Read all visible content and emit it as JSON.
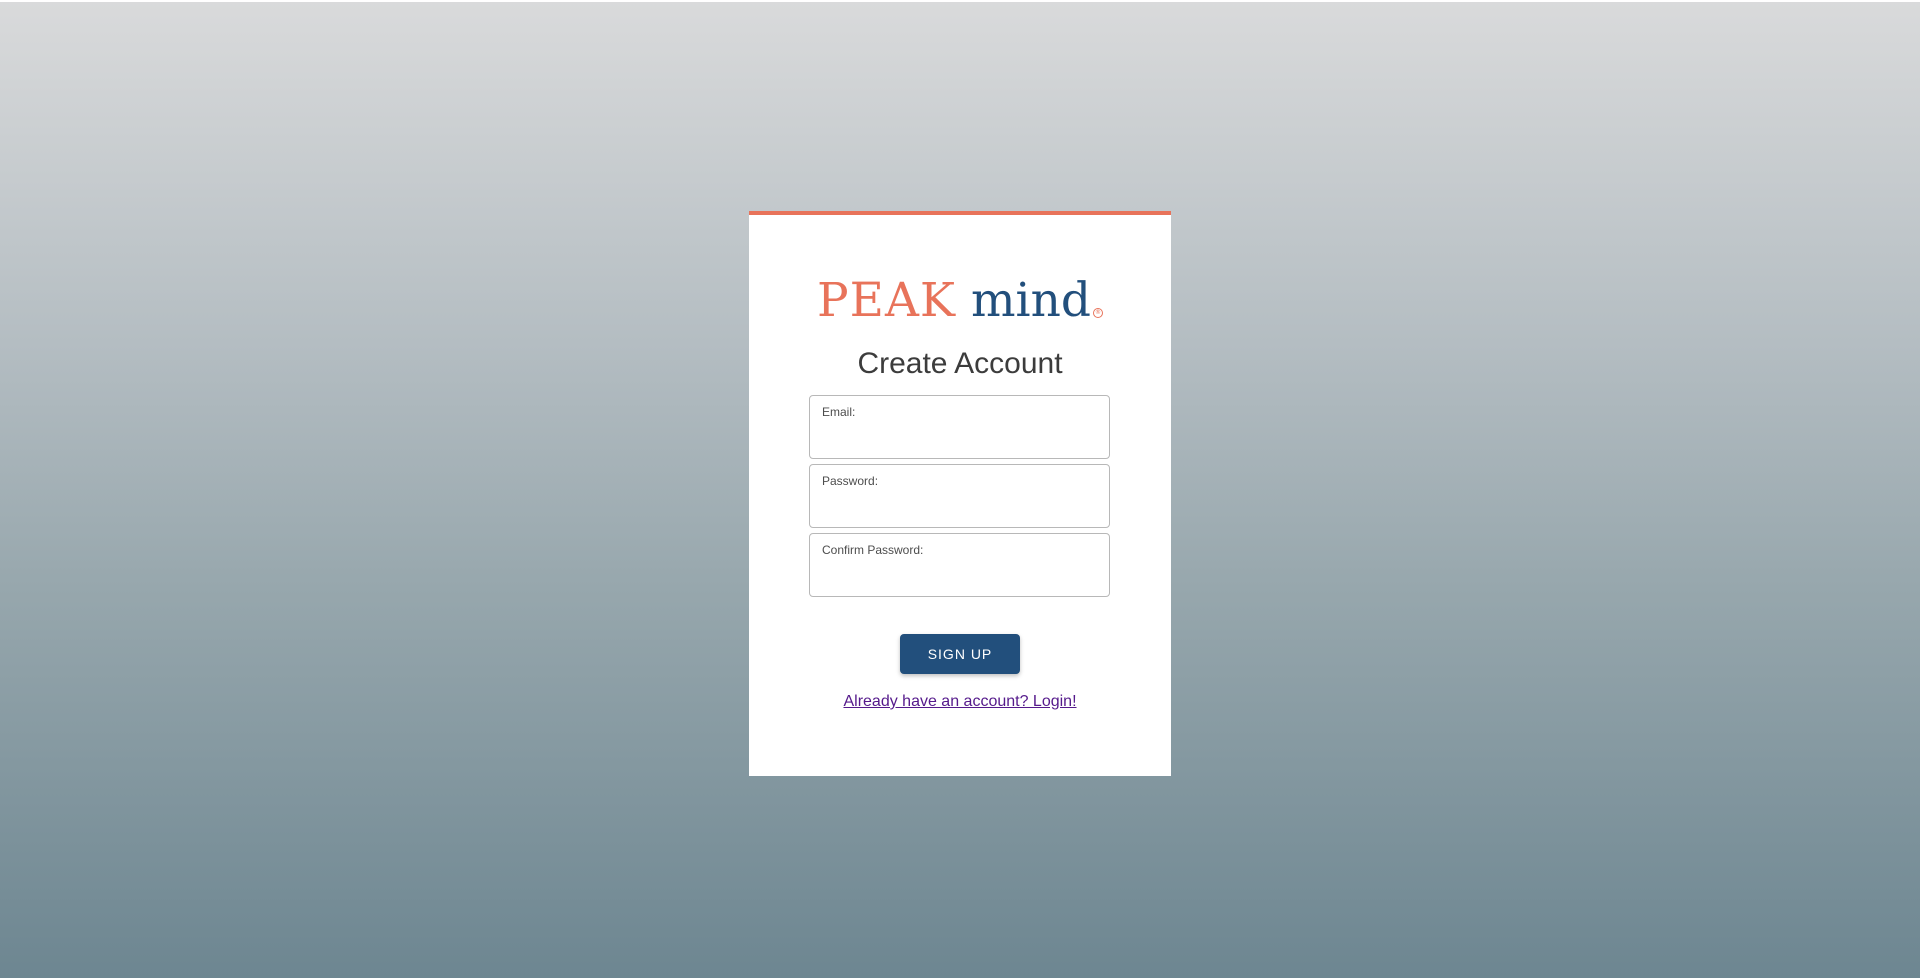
{
  "logo": {
    "word1": "PEAK",
    "word2": "mind",
    "mark": "®",
    "colors": {
      "peak": "#e8735a",
      "mind": "#224f7c"
    }
  },
  "form": {
    "title": "Create Account",
    "fields": [
      {
        "label": "Email:",
        "value": ""
      },
      {
        "label": "Password:",
        "value": ""
      },
      {
        "label": "Confirm Password:",
        "value": ""
      }
    ],
    "submit_label": "SIGN UP",
    "login_link": "Already have an account? Login!"
  },
  "colors": {
    "accent": "#e8735a",
    "primary": "#224f7c",
    "link": "#551a8b"
  }
}
